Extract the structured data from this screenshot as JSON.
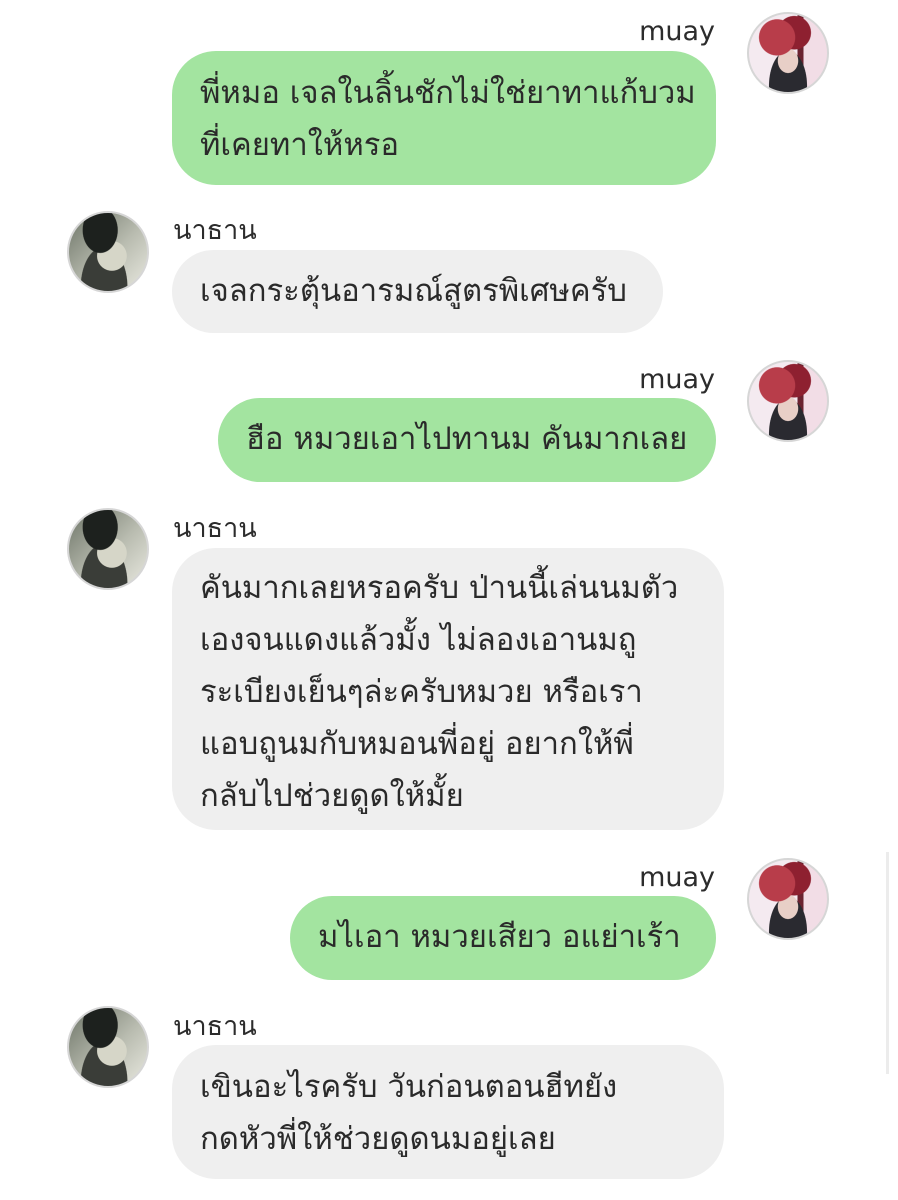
{
  "participants": {
    "self": {
      "name": "muay",
      "avatar_icon": "muay-avatar-icon"
    },
    "other": {
      "name": "นาธาน",
      "avatar_icon": "nathan-avatar-icon"
    }
  },
  "colors": {
    "outgoing_bubble": "#a3e4a0",
    "incoming_bubble": "#efefef",
    "background": "#ffffff"
  },
  "messages": [
    {
      "sender": "muay",
      "lines": [
        "พี่หมอ เจลในลิ้นชักไม่ใช่ยาทาแก้บวม",
        "ที่เคยทาให้หรอ"
      ]
    },
    {
      "sender": "นาธาน",
      "lines": [
        "เจลกระตุ้นอารมณ์สูตรพิเศษครับ"
      ]
    },
    {
      "sender": "muay",
      "lines": [
        "ฮือ หมวยเอาไปทานม คันมากเลย"
      ]
    },
    {
      "sender": "นาธาน",
      "lines": [
        "คันมากเลยหรอครับ ป่านนี้เล่นนมตัว",
        "เองจนแดงแล้วมั้ง ไม่ลองเอานมถู",
        "ระเบียงเย็นๆล่ะครับหมวย หรือเรา",
        "แอบถูนมกับหมอนพี่อยู่ อยากให้พี่",
        "กลับไปช่วยดูดให้มั้ย"
      ]
    },
    {
      "sender": "muay",
      "lines": [
        "มไเอา หมวยเสียว อแย่าเร้า"
      ]
    },
    {
      "sender": "นาธาน",
      "lines": [
        "เขินอะไรครับ วันก่อนตอนฮีทยัง",
        "กดหัวพี่ให้ช่วยดูดนมอยู่เลย"
      ]
    }
  ]
}
